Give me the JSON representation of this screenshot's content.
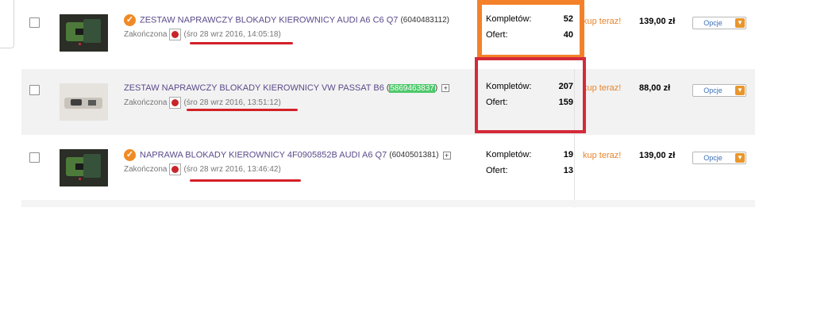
{
  "listings": [
    {
      "title": "ZESTAW NAPRAWCZY BLOKADY KIEROWNICY AUDI A6 C6 Q7",
      "item_id": "(6040483112)",
      "status": "Zakończona",
      "date": "(śro 28 wrz 2016, 14:05:18)",
      "kompletow_label": "Kompletów:",
      "kompletow": "52",
      "ofert_label": "Ofert:",
      "ofert": "40",
      "buy_now": "kup teraz!",
      "price": "139,00 zł",
      "options_label": "Opcje"
    },
    {
      "title": "ZESTAW NAPRAWCZY BLOKADY KIEROWNICY VW PASSAT B6",
      "item_id_prefix": "(",
      "item_id": "5869463837",
      "item_id_suffix": ")",
      "status": "Zakończona",
      "date": "(śro 28 wrz 2016, 13:51:12)",
      "kompletow_label": "Kompletów:",
      "kompletow": "207",
      "ofert_label": "Ofert:",
      "ofert": "159",
      "buy_now": "kup teraz!",
      "price": "88,00 zł",
      "options_label": "Opcje"
    },
    {
      "title": "NAPRAWA BLOKADY KIEROWNICY 4F0905852B AUDI A6 Q7",
      "item_id": "(6040501381)",
      "status": "Zakończona",
      "date": "(śro 28 wrz 2016, 13:46:42)",
      "kompletow_label": "Kompletów:",
      "kompletow": "19",
      "ofert_label": "Ofert:",
      "ofert": "13",
      "buy_now": "kup teraz!",
      "price": "139,00 zł",
      "options_label": "Opcje"
    }
  ],
  "icons": {
    "status": "check-circle-icon",
    "clock": "clock-icon",
    "plus": "plus-icon",
    "dropdown": "chevron-down-icon"
  },
  "colors": {
    "title_link": "#5a4a8a",
    "buy_now": "#e8852a",
    "annotation_orange": "#f4812a",
    "annotation_red": "#d42a3a",
    "id_highlight": "#4ec96b"
  }
}
